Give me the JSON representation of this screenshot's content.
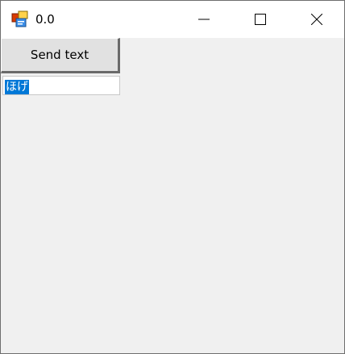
{
  "window": {
    "title": "0.0"
  },
  "icons": {
    "app": "application-icon",
    "minimize": "minimize-icon",
    "maximize": "maximize-icon",
    "close": "close-icon"
  },
  "form": {
    "send_button_label": "Send text",
    "text_value": "ほげ"
  },
  "colors": {
    "selection": "#0078d7",
    "client_background": "#f0f0f0",
    "button_face": "#e1e1e1"
  }
}
